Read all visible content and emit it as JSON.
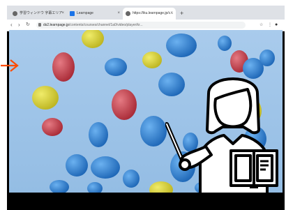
{
  "browser": {
    "tabs": [
      {
        "label": "学習ウィンドウ 字幕エリア",
        "icon": "globe-icon",
        "color": "#4a4a4a"
      },
      {
        "label": "Learnpage",
        "icon": "document-icon",
        "color": "#1a73e8"
      },
      {
        "label": "https://iku.learnpage.jp/c...",
        "icon": "globe-icon",
        "color": "#4a4a4a",
        "active": true
      }
    ],
    "new_tab": "+",
    "omnibox": {
      "host": "ds2.learnpage.jp",
      "path": "/contents/courses/channel/1a0/video/player/kr..."
    }
  },
  "icons": {
    "back": "back-arrow-icon",
    "forward": "forward-arrow-icon",
    "reload": "reload-icon",
    "presenter": "teacher-with-pointer-icon",
    "book": "open-book-icon",
    "pointer": "orange-arrow-icon"
  },
  "colors": {
    "sky": "#9fc3e6",
    "balloon_blue": "#2e7fd0",
    "balloon_red": "#c8434f",
    "balloon_yellow": "#d8d43a",
    "arrow": "#ff4c00"
  }
}
